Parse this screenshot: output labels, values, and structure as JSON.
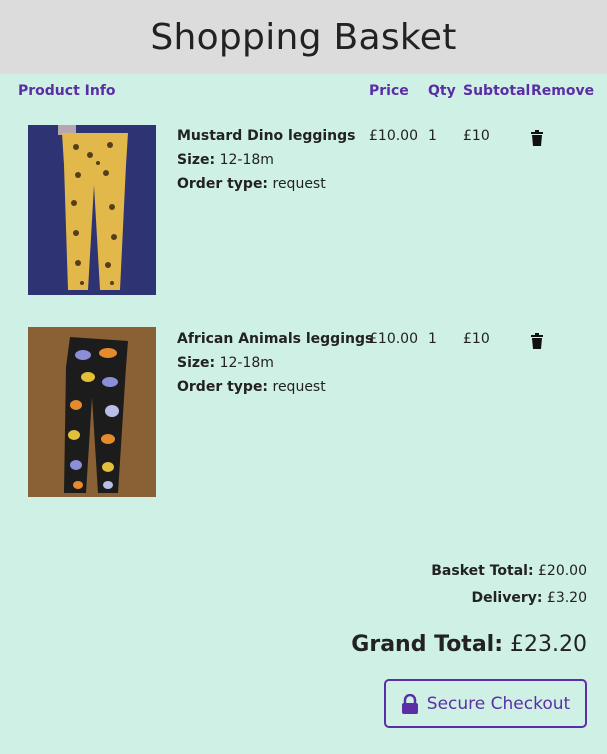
{
  "header": {
    "title": "Shopping Basket"
  },
  "columns": {
    "product_info": "Product Info",
    "price": "Price",
    "qty": "Qty",
    "subtotal": "Subtotal",
    "remove": "Remove"
  },
  "items": [
    {
      "name": "Mustard Dino leggings",
      "size_label": "Size:",
      "size": "12-18m",
      "order_type_label": "Order type:",
      "order_type": "request",
      "price": "£10.00",
      "qty": "1",
      "subtotal": "£10"
    },
    {
      "name": "African Animals leggings",
      "size_label": "Size:",
      "size": "12-18m",
      "order_type_label": "Order type:",
      "order_type": "request",
      "price": "£10.00",
      "qty": "1",
      "subtotal": "£10"
    }
  ],
  "summary": {
    "basket_total_label": "Basket Total:",
    "basket_total": "£20.00",
    "delivery_label": "Delivery:",
    "delivery": "£3.20",
    "grand_total_label": "Grand Total:",
    "grand_total": "£23.20"
  },
  "checkout": {
    "label": "Secure Checkout",
    "icon": "lock-icon"
  },
  "colors": {
    "accent": "#5b2ea6",
    "background": "#cff0e4",
    "header_bg": "#dcdcdc"
  }
}
